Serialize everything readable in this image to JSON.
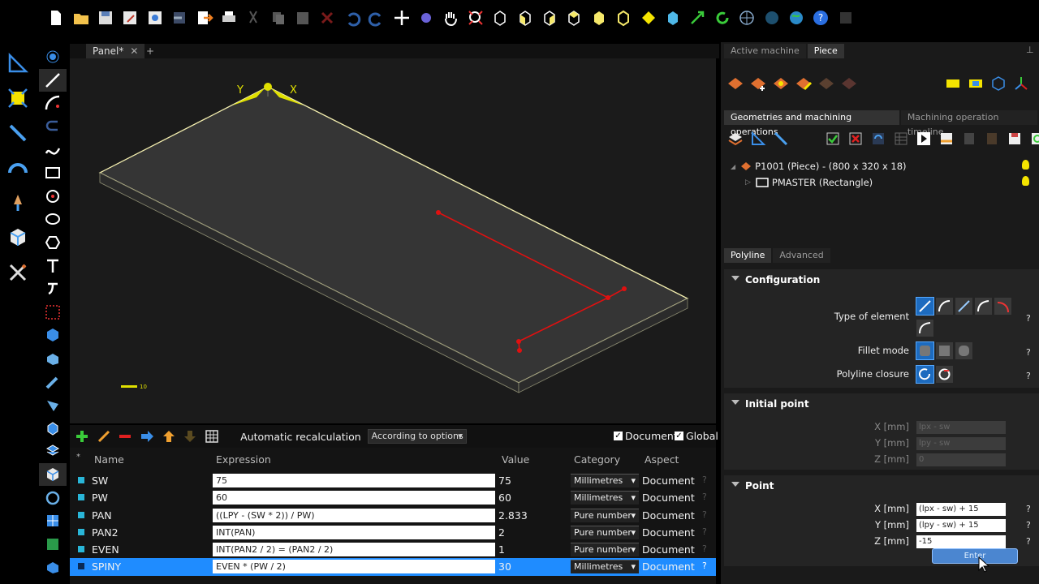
{
  "document_tab": {
    "label": "Panel*",
    "close": "✕",
    "add": "+"
  },
  "viewport": {
    "axis_x": "X",
    "axis_y": "Y",
    "scale_label": "10"
  },
  "variables_toolbar": {
    "auto_label": "Automatic recalculation",
    "recalc_value": "According to options",
    "document_label": "Document",
    "global_label": "Global"
  },
  "variables": {
    "headers": {
      "star": "*",
      "name": "Name",
      "expression": "Expression",
      "value": "Value",
      "category": "Category",
      "aspect": "Aspect"
    },
    "rows": [
      {
        "name": "SW",
        "expression": "75",
        "value": "75",
        "category": "Millimetres",
        "aspect": "Document",
        "q": "?"
      },
      {
        "name": "PW",
        "expression": "60",
        "value": "60",
        "category": "Millimetres",
        "aspect": "Document",
        "q": "?"
      },
      {
        "name": "PAN",
        "expression": "((LPY - (SW * 2)) / PW)",
        "value": "2.833",
        "category": "Pure number",
        "aspect": "Document",
        "q": "?"
      },
      {
        "name": "PAN2",
        "expression": "INT(PAN)",
        "value": "2",
        "category": "Pure number",
        "aspect": "Document",
        "q": "?"
      },
      {
        "name": "EVEN",
        "expression": "INT(PAN2 / 2) = (PAN2 / 2)",
        "value": "1",
        "category": "Pure number",
        "aspect": "Document",
        "q": "?"
      },
      {
        "name": "SPINY",
        "expression": "EVEN * (PW / 2)",
        "value": "30",
        "category": "Millimetres",
        "aspect": "Document",
        "q": "?"
      }
    ]
  },
  "right_panel": {
    "top_tabs": [
      "Active machine",
      "Piece"
    ],
    "pin": "⊥",
    "mid_tabs": [
      "Geometries and machining operations",
      "Machining operation timeline"
    ],
    "tree": {
      "piece": "P1001 (Piece) - (800 x 320 x 18)",
      "child": "PMASTER (Rectangle)"
    },
    "prop_tabs": [
      "Polyline",
      "Advanced"
    ],
    "configuration": {
      "title": "Configuration",
      "type_label": "Type of element",
      "fillet_label": "Fillet mode",
      "closure_label": "Polyline closure",
      "q": "?"
    },
    "initial_point": {
      "title": "Initial point",
      "x_label": "X [mm]",
      "x_value": "lpx - sw",
      "y_label": "Y [mm]",
      "y_value": "lpy - sw",
      "z_label": "Z [mm]",
      "z_value": "0"
    },
    "point": {
      "title": "Point",
      "x_label": "X [mm]",
      "x_value": "(lpx - sw) + 15",
      "y_label": "Y [mm]",
      "y_value": "(lpy - sw) + 15",
      "z_label": "Z [mm]",
      "z_value": "-15",
      "q": "?"
    },
    "enter_label": "Enter"
  },
  "colors": {
    "accent": "#1f8cff",
    "panel_edge": "#f5f0b0",
    "polyline": "#e01010",
    "handle": "#e0e000"
  }
}
